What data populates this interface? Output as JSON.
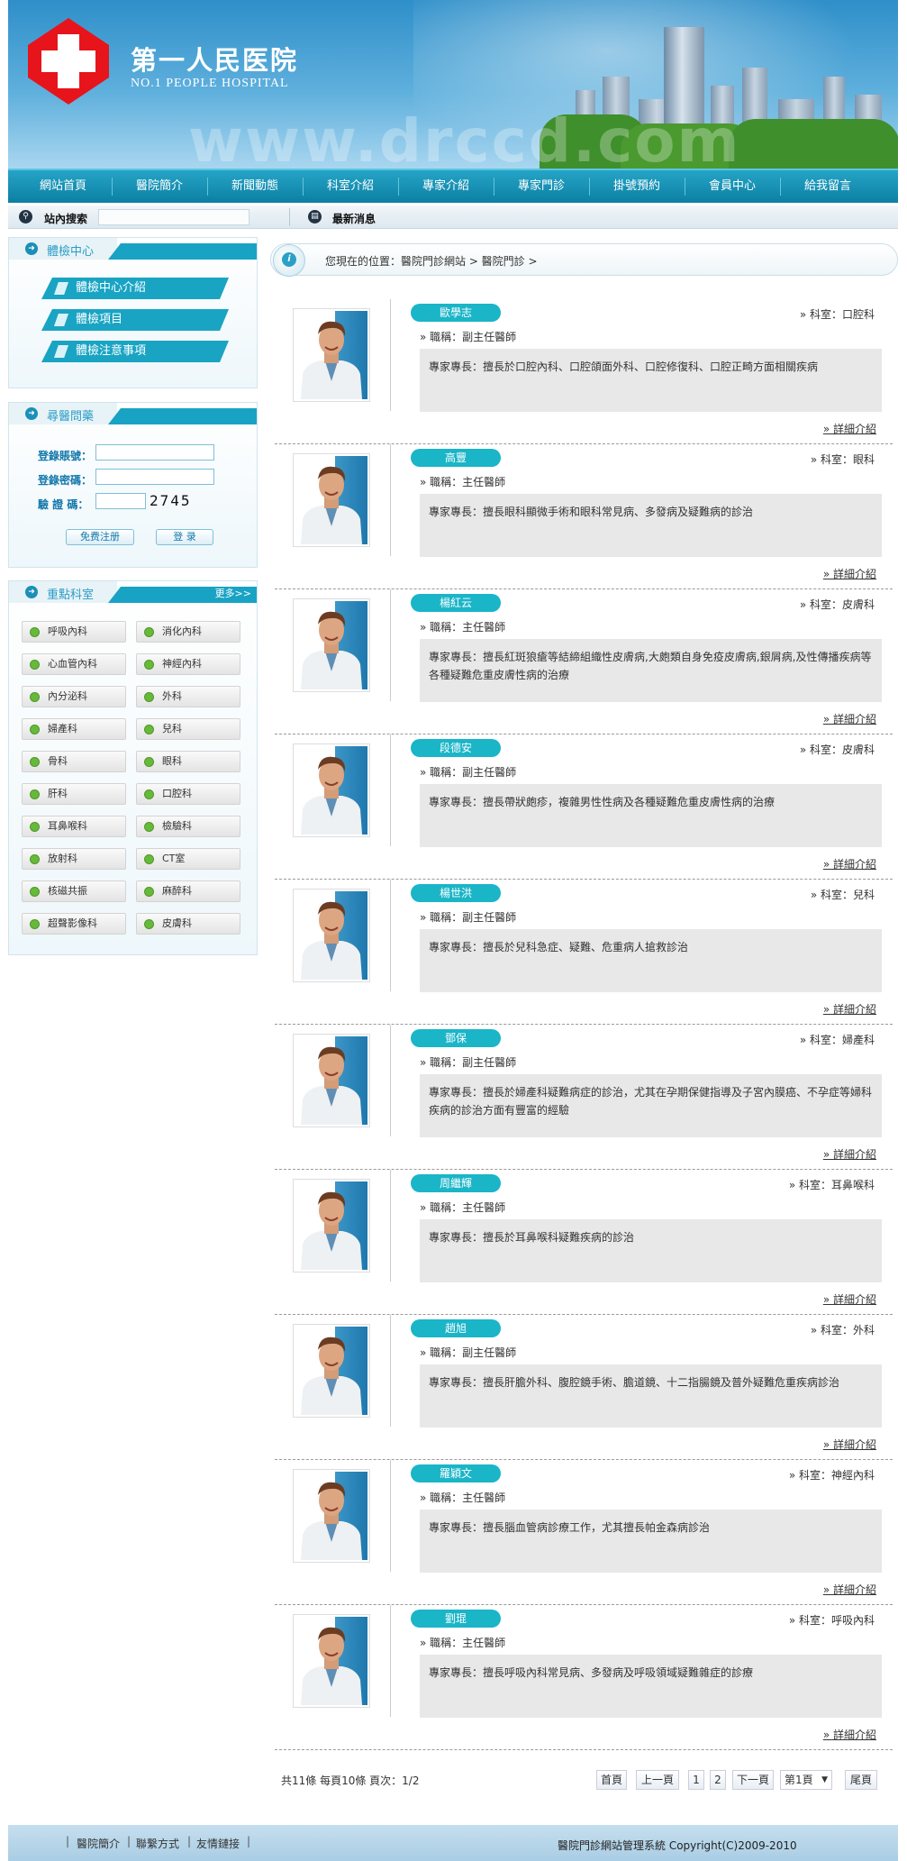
{
  "header": {
    "title": "第一人民医院",
    "subtitle": "NO.1 PEOPLE HOSPITAL",
    "watermark": "www.drccd.com"
  },
  "nav": [
    "網站首頁",
    "醫院簡介",
    "新聞動態",
    "科室介紹",
    "專家介紹",
    "專家門診",
    "掛號預約",
    "會員中心",
    "給我留言"
  ],
  "searchbar": {
    "search_label": "站內搜索",
    "search_value": "",
    "news_label": "最新消息"
  },
  "sidebar": {
    "exam": {
      "title": "體檢中心",
      "items": [
        "體檢中心介紹",
        "體檢項目",
        "體檢注意事項"
      ]
    },
    "consult": {
      "title": "尋醫問藥",
      "account_label": "登錄賬號：",
      "password_label": "登錄密碼：",
      "captcha_label": "驗 證 碼：",
      "captcha_code": "2745",
      "register_label": "免费注册",
      "login_label": "登 录"
    },
    "depts": {
      "title": "重點科室",
      "more_label": "更多>>",
      "items": [
        "呼吸內科",
        "消化內科",
        "心血管內科",
        "神經內科",
        "內分泌科",
        "外科",
        "婦產科",
        "兒科",
        "骨科",
        "眼科",
        "肝科",
        "口腔科",
        "耳鼻喉科",
        "檢驗科",
        "放射科",
        "CT室",
        "核磁共振",
        "麻醉科",
        "超聲影像科",
        "皮膚科"
      ]
    }
  },
  "breadcrumb": "您現在的位置：醫院門診網站 > 醫院門診 >",
  "experts": [
    {
      "name": "歐學志",
      "dept": "» 科室：口腔科",
      "title": "» 職稱：副主任醫師",
      "spec": "專家專長：擅長於口腔內科、口腔頜面外科、口腔修復科、口腔正畸方面相關疾病",
      "more": "» 詳細介紹"
    },
    {
      "name": "高豐",
      "dept": "» 科室：眼科",
      "title": "» 職稱：主任醫師",
      "spec": "專家專長：擅長眼科顯微手術和眼科常見病、多發病及疑難病的診治",
      "more": "» 詳細介紹"
    },
    {
      "name": "楊紅云",
      "dept": "» 科室：皮膚科",
      "title": "» 職稱：主任醫師",
      "spec": "專家專長：擅長紅斑狼瘡等結締組織性皮膚病,大皰類自身免疫皮膚病,銀屑病,及性傳播疾病等各種疑難危重皮膚性病的治療",
      "more": "» 詳細介紹"
    },
    {
      "name": "段德安",
      "dept": "» 科室：皮膚科",
      "title": "» 職稱：副主任醫師",
      "spec": "專家專長：擅長帶狀皰疹，複雜男性性病及各種疑難危重皮膚性病的治療",
      "more": "» 詳細介紹"
    },
    {
      "name": "楊世洪",
      "dept": "» 科室：兒科",
      "title": "» 職稱：副主任醫師",
      "spec": "專家專長：擅長於兒科急症、疑難、危重病人搶救診治",
      "more": "» 詳細介紹"
    },
    {
      "name": "鄧保",
      "dept": "» 科室：婦產科",
      "title": "» 職稱：副主任醫師",
      "spec": "專家專長：擅長於婦產科疑難病症的診治，尤其在孕期保健指導及子宮內膜癌、不孕症等婦科疾病的診治方面有豐富的經驗",
      "more": "» 詳細介紹"
    },
    {
      "name": "周繼輝",
      "dept": "» 科室：耳鼻喉科",
      "title": "» 職稱：主任醫師",
      "spec": "專家專長：擅長於耳鼻喉科疑難疾病的診治",
      "more": "» 詳細介紹"
    },
    {
      "name": "趙旭",
      "dept": "» 科室：外科",
      "title": "» 職稱：副主任醫師",
      "spec": "專家專長：擅長肝膽外科、腹腔鏡手術、膽道鏡、十二指腸鏡及普外疑難危重疾病診治",
      "more": "» 詳細介紹"
    },
    {
      "name": "羅穎文",
      "dept": "» 科室：神經內科",
      "title": "» 職稱：主任醫師",
      "spec": "專家專長：擅長腦血管病診療工作，尤其擅長帕金森病診治",
      "more": "» 詳細介紹"
    },
    {
      "name": "劉琨",
      "dept": "» 科室：呼吸內科",
      "title": "» 職稱：主任醫師",
      "spec": "專家專長：擅長呼吸內科常見病、多發病及呼吸領域疑難雜症的診療",
      "more": "» 詳細介紹"
    }
  ],
  "pagination": {
    "summary": "共11條 每頁10條 頁次：1/2",
    "first": "首頁",
    "prev": "上一頁",
    "p1": "1",
    "p2": "2",
    "next": "下一頁",
    "select": "第1頁",
    "last": "尾頁"
  },
  "footer": {
    "links": [
      "醫院簡介",
      "聯繫方式",
      "友情鏈接"
    ],
    "copyright": "醫院門診網站管理系統 Copyright(C)2009-2010"
  },
  "colors": {
    "accent": "#1aa4c4",
    "nav": "#0c7fa3",
    "logo_red": "#e8141b"
  }
}
